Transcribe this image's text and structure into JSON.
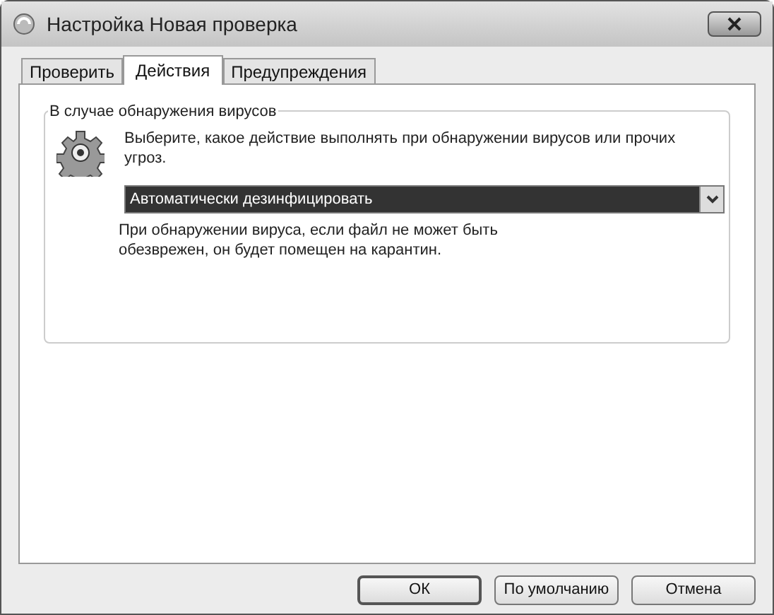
{
  "window": {
    "title": "Настройка Новая проверка"
  },
  "tabs": [
    {
      "label": "Проверить",
      "selected": false
    },
    {
      "label": "Действия",
      "selected": true
    },
    {
      "label": "Предупреждения",
      "selected": false
    }
  ],
  "group": {
    "title": "В случае обнаружения вирусов",
    "prompt": "Выберите, какое действие выполнять при обнаружении вирусов или прочих угроз.",
    "action_select": {
      "value": "Автоматически дезинфицировать",
      "focused": true
    },
    "note": "При обнаружении вируса, если файл не может быть обезврежен, он будет помещен на карантин."
  },
  "buttons": [
    {
      "label": "ОК",
      "default": true
    },
    {
      "label": "По умолчанию",
      "default": false
    },
    {
      "label": "Отмена",
      "default": false
    }
  ]
}
